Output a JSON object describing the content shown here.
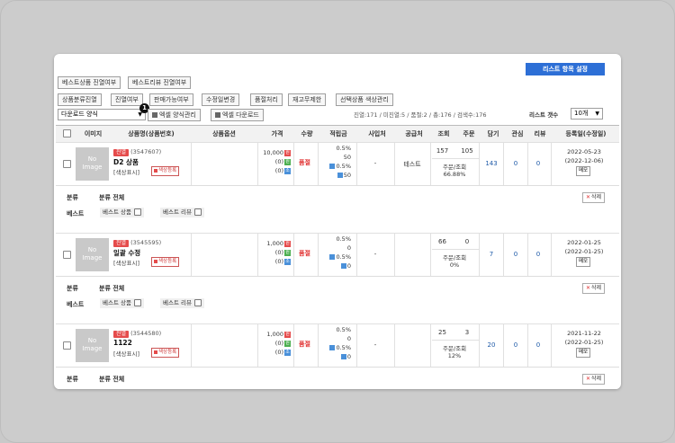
{
  "toolbar": {
    "best_product_btn": "베스트상품 진열여부",
    "best_review_btn": "베스트리뷰 진열여부",
    "list_setting_btn": "리스트 항목 설정",
    "row2": [
      "상품분류진열",
      "진열여부",
      "판매가능여부",
      "수정일변경",
      "품절처리",
      "재고무제한",
      "선택상품 색상관리"
    ],
    "download_select": "다운로드 양식",
    "excel_format_btn": "엑셀 양식관리",
    "excel_download_btn": "엑셀 다운로드",
    "callout_number": "1",
    "stats": "진열:171 / 미진열:5 / 품절:2 / 총:176 / 검색수:176",
    "list_count_label": "리스트 갯수",
    "list_count_value": "10개"
  },
  "headers": [
    "이미지",
    "상품명(상품번호)",
    "상품옵션",
    "가격",
    "수량",
    "적립금",
    "사입처",
    "공급처",
    "조회",
    "주문",
    "담기",
    "관심",
    "리뷰",
    "등록일(수정일)"
  ],
  "rows": [
    {
      "image_text": [
        "No",
        "Image"
      ],
      "tag": "진열",
      "product_no": "(3547607)",
      "name": "D2 상품",
      "color_text": "[색상표시]",
      "color_btn": "색상등록",
      "price": "10,000",
      "price_a": "(0)",
      "price_b": "(0)",
      "qty": "품절",
      "point_pct": "0.5%",
      "point_val": "50",
      "point_pct2": "0.5%",
      "point_val2": "50",
      "purchase": "-",
      "supplier": "테스트",
      "views": "157",
      "orders": "105",
      "order_ratio_label": "주문/조회",
      "order_ratio": "66.88%",
      "cart": "143",
      "wish": "0",
      "review": "0",
      "reg_date": "2022-05-23",
      "mod_date": "(2022-12-06)",
      "memo": "메모",
      "category_label": "분류",
      "category_value": "분류 전체",
      "best_label": "베스트",
      "best_product": "베스트 상품",
      "best_review": "베스트 리뷰",
      "delete": "삭제"
    },
    {
      "image_text": [
        "No",
        "Image"
      ],
      "tag": "진열",
      "product_no": "(3545595)",
      "name": "일괄 수정",
      "color_text": "[색상표시]",
      "color_btn": "색상등록",
      "price": "1,000",
      "price_a": "(0)",
      "price_b": "(0)",
      "qty": "품절",
      "point_pct": "0.5%",
      "point_val": "0",
      "point_pct2": "0.5%",
      "point_val2": "0",
      "purchase": "-",
      "supplier": "",
      "views": "66",
      "orders": "0",
      "order_ratio_label": "주문/조회",
      "order_ratio": "0%",
      "cart": "7",
      "wish": "0",
      "review": "0",
      "reg_date": "2022-01-25",
      "mod_date": "(2022-01-25)",
      "memo": "메모",
      "category_label": "분류",
      "category_value": "분류 전체",
      "best_label": "베스트",
      "best_product": "베스트 상품",
      "best_review": "베스트 리뷰",
      "delete": "삭제"
    },
    {
      "image_text": [
        "No",
        "Image"
      ],
      "tag": "진열",
      "product_no": "(3544580)",
      "name": "1122",
      "color_text": "[색상표시]",
      "color_btn": "색상등록",
      "price": "1,000",
      "price_a": "(0)",
      "price_b": "(0)",
      "qty": "품절",
      "point_pct": "0.5%",
      "point_val": "0",
      "point_pct2": "0.5%",
      "point_val2": "0",
      "purchase": "-",
      "supplier": "",
      "views": "25",
      "orders": "3",
      "order_ratio_label": "주문/조회",
      "order_ratio": "12%",
      "cart": "20",
      "wish": "0",
      "review": "0",
      "reg_date": "2021-11-22",
      "mod_date": "(2022-01-25)",
      "memo": "메모",
      "category_label": "분류",
      "category_value": "분류 전체",
      "best_label": "베스트",
      "best_product": "베스트 상품",
      "best_review": "베스트 리뷰",
      "delete": "삭제"
    }
  ],
  "icons": {
    "price_mini_a": "원",
    "price_mini_b": "소",
    "point_icon": "point-icon"
  },
  "colors": {
    "accent": "#2d6fd6",
    "tag": "#e54b4b",
    "soldout": "#e03030",
    "link": "#1e5aa8"
  }
}
